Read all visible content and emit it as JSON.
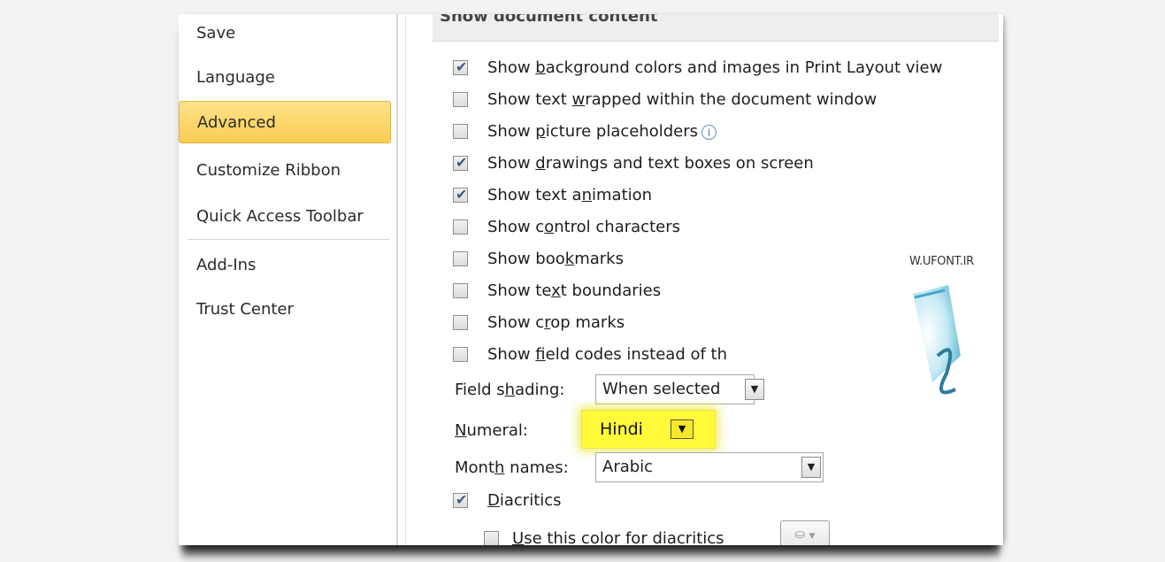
{
  "sidebar": {
    "items": [
      {
        "label": "Save",
        "selected": false
      },
      {
        "label": "Language",
        "selected": false
      },
      {
        "label": "Advanced",
        "selected": true
      },
      {
        "label": "Customize Ribbon",
        "selected": false
      },
      {
        "label": "Quick Access Toolbar",
        "selected": false
      },
      {
        "label": "Add-Ins",
        "selected": false
      },
      {
        "label": "Trust Center",
        "selected": false
      }
    ]
  },
  "section": {
    "title": "Show document content"
  },
  "options": [
    {
      "pre": "Show ",
      "key": "b",
      "post": "ackground colors and images in Print Layout view",
      "checked": true
    },
    {
      "pre": "Show text ",
      "key": "w",
      "post": "rapped within the document window",
      "checked": false
    },
    {
      "pre": "Show ",
      "key": "p",
      "post": "icture placeholders",
      "checked": false
    },
    {
      "pre": "Show ",
      "key": "d",
      "post": "rawings and text boxes on screen",
      "checked": true
    },
    {
      "pre": "Show text a",
      "key": "n",
      "post": "imation",
      "checked": true
    },
    {
      "pre": "Show c",
      "key": "o",
      "post": "ntrol characters",
      "checked": false
    },
    {
      "pre": "Show boo",
      "key": "k",
      "post": "marks",
      "checked": false
    },
    {
      "pre": "Show te",
      "key": "x",
      "post": "t boundaries",
      "checked": false
    },
    {
      "pre": "Show c",
      "key": "r",
      "post": "op marks",
      "checked": false
    },
    {
      "pre": "Show ",
      "key": "f",
      "post": "ield codes instead of th",
      "checked": false
    }
  ],
  "field_shading": {
    "pre": "Field s",
    "key": "h",
    "post": "ading:",
    "value": "When selected"
  },
  "numeral": {
    "pre": "",
    "key": "N",
    "post": "umeral:",
    "value": "Hindi",
    "highlight_color": "#fffb3a"
  },
  "month_names": {
    "pre": "Mont",
    "key": "h",
    "post": " names:",
    "value": "Arabic"
  },
  "diacritics": {
    "pre": "",
    "key": "D",
    "post": "iacritics",
    "checked": true
  },
  "diacritics_color": {
    "pre": "",
    "key": "U",
    "post": "se this color for diacritics",
    "checked": false
  },
  "watermark": {
    "text": "W.UFONT.IR"
  },
  "icons": {
    "info": "info-icon",
    "dropdown": "chevron-down-icon",
    "paint": "paint-bucket-icon"
  },
  "colors": {
    "selected_nav": "#fbcc52",
    "check": "#3c5a8a"
  }
}
